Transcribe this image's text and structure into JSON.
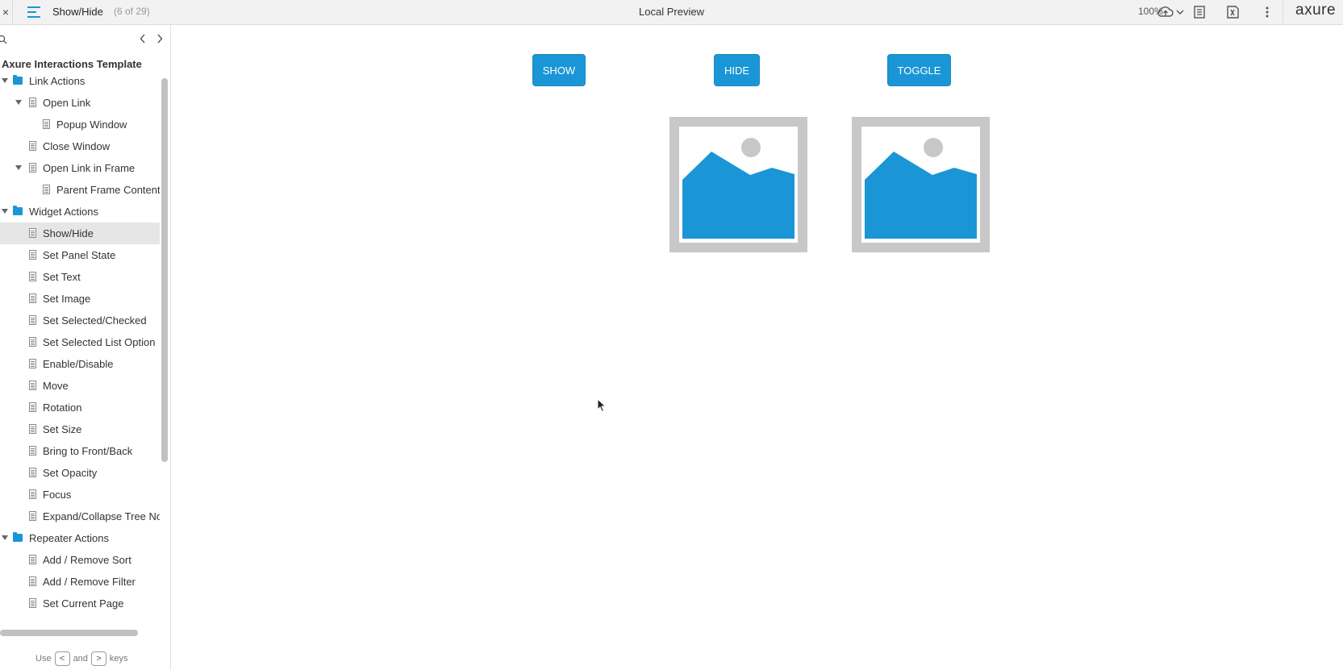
{
  "topbar": {
    "close": "×",
    "page_name": "Show/Hide",
    "page_count": "(6 of 29)",
    "center_title": "Local Preview",
    "zoom": "100%",
    "brand": "axure"
  },
  "sidebar": {
    "project_title": "Axure Interactions Template",
    "hint": {
      "use": "Use",
      "key_prev": "<",
      "and": "and",
      "key_next": ">",
      "keys": "keys"
    },
    "items": [
      {
        "label": "Link Actions",
        "type": "folder",
        "level": 0,
        "expanded": true
      },
      {
        "label": "Open Link",
        "type": "page",
        "level": 1,
        "expanded": true
      },
      {
        "label": "Popup Window",
        "type": "page",
        "level": 2
      },
      {
        "label": "Close Window",
        "type": "page",
        "level": 1
      },
      {
        "label": "Open Link in Frame",
        "type": "page",
        "level": 1,
        "expanded": true
      },
      {
        "label": "Parent Frame Content",
        "type": "page",
        "level": 2
      },
      {
        "label": "Widget Actions",
        "type": "folder",
        "level": 0,
        "expanded": true
      },
      {
        "label": "Show/Hide",
        "type": "page",
        "level": 1,
        "selected": true
      },
      {
        "label": "Set Panel State",
        "type": "page",
        "level": 1
      },
      {
        "label": "Set Text",
        "type": "page",
        "level": 1
      },
      {
        "label": "Set Image",
        "type": "page",
        "level": 1
      },
      {
        "label": "Set Selected/Checked",
        "type": "page",
        "level": 1
      },
      {
        "label": "Set Selected List Option",
        "type": "page",
        "level": 1
      },
      {
        "label": "Enable/Disable",
        "type": "page",
        "level": 1
      },
      {
        "label": "Move",
        "type": "page",
        "level": 1
      },
      {
        "label": "Rotation",
        "type": "page",
        "level": 1
      },
      {
        "label": "Set Size",
        "type": "page",
        "level": 1
      },
      {
        "label": "Bring to Front/Back",
        "type": "page",
        "level": 1
      },
      {
        "label": "Set Opacity",
        "type": "page",
        "level": 1
      },
      {
        "label": "Focus",
        "type": "page",
        "level": 1
      },
      {
        "label": "Expand/Collapse Tree Node",
        "type": "page",
        "level": 1
      },
      {
        "label": "Repeater Actions",
        "type": "folder",
        "level": 0,
        "expanded": true
      },
      {
        "label": "Add / Remove Sort",
        "type": "page",
        "level": 1
      },
      {
        "label": "Add / Remove Filter",
        "type": "page",
        "level": 1
      },
      {
        "label": "Set Current Page",
        "type": "page",
        "level": 1
      }
    ]
  },
  "canvas": {
    "show_label": "SHOW",
    "hide_label": "HIDE",
    "toggle_label": "TOGGLE"
  },
  "colors": {
    "accent": "#1a96d6",
    "placeholder_frame": "#c8c8c8",
    "sun": "#c8c8c8"
  }
}
